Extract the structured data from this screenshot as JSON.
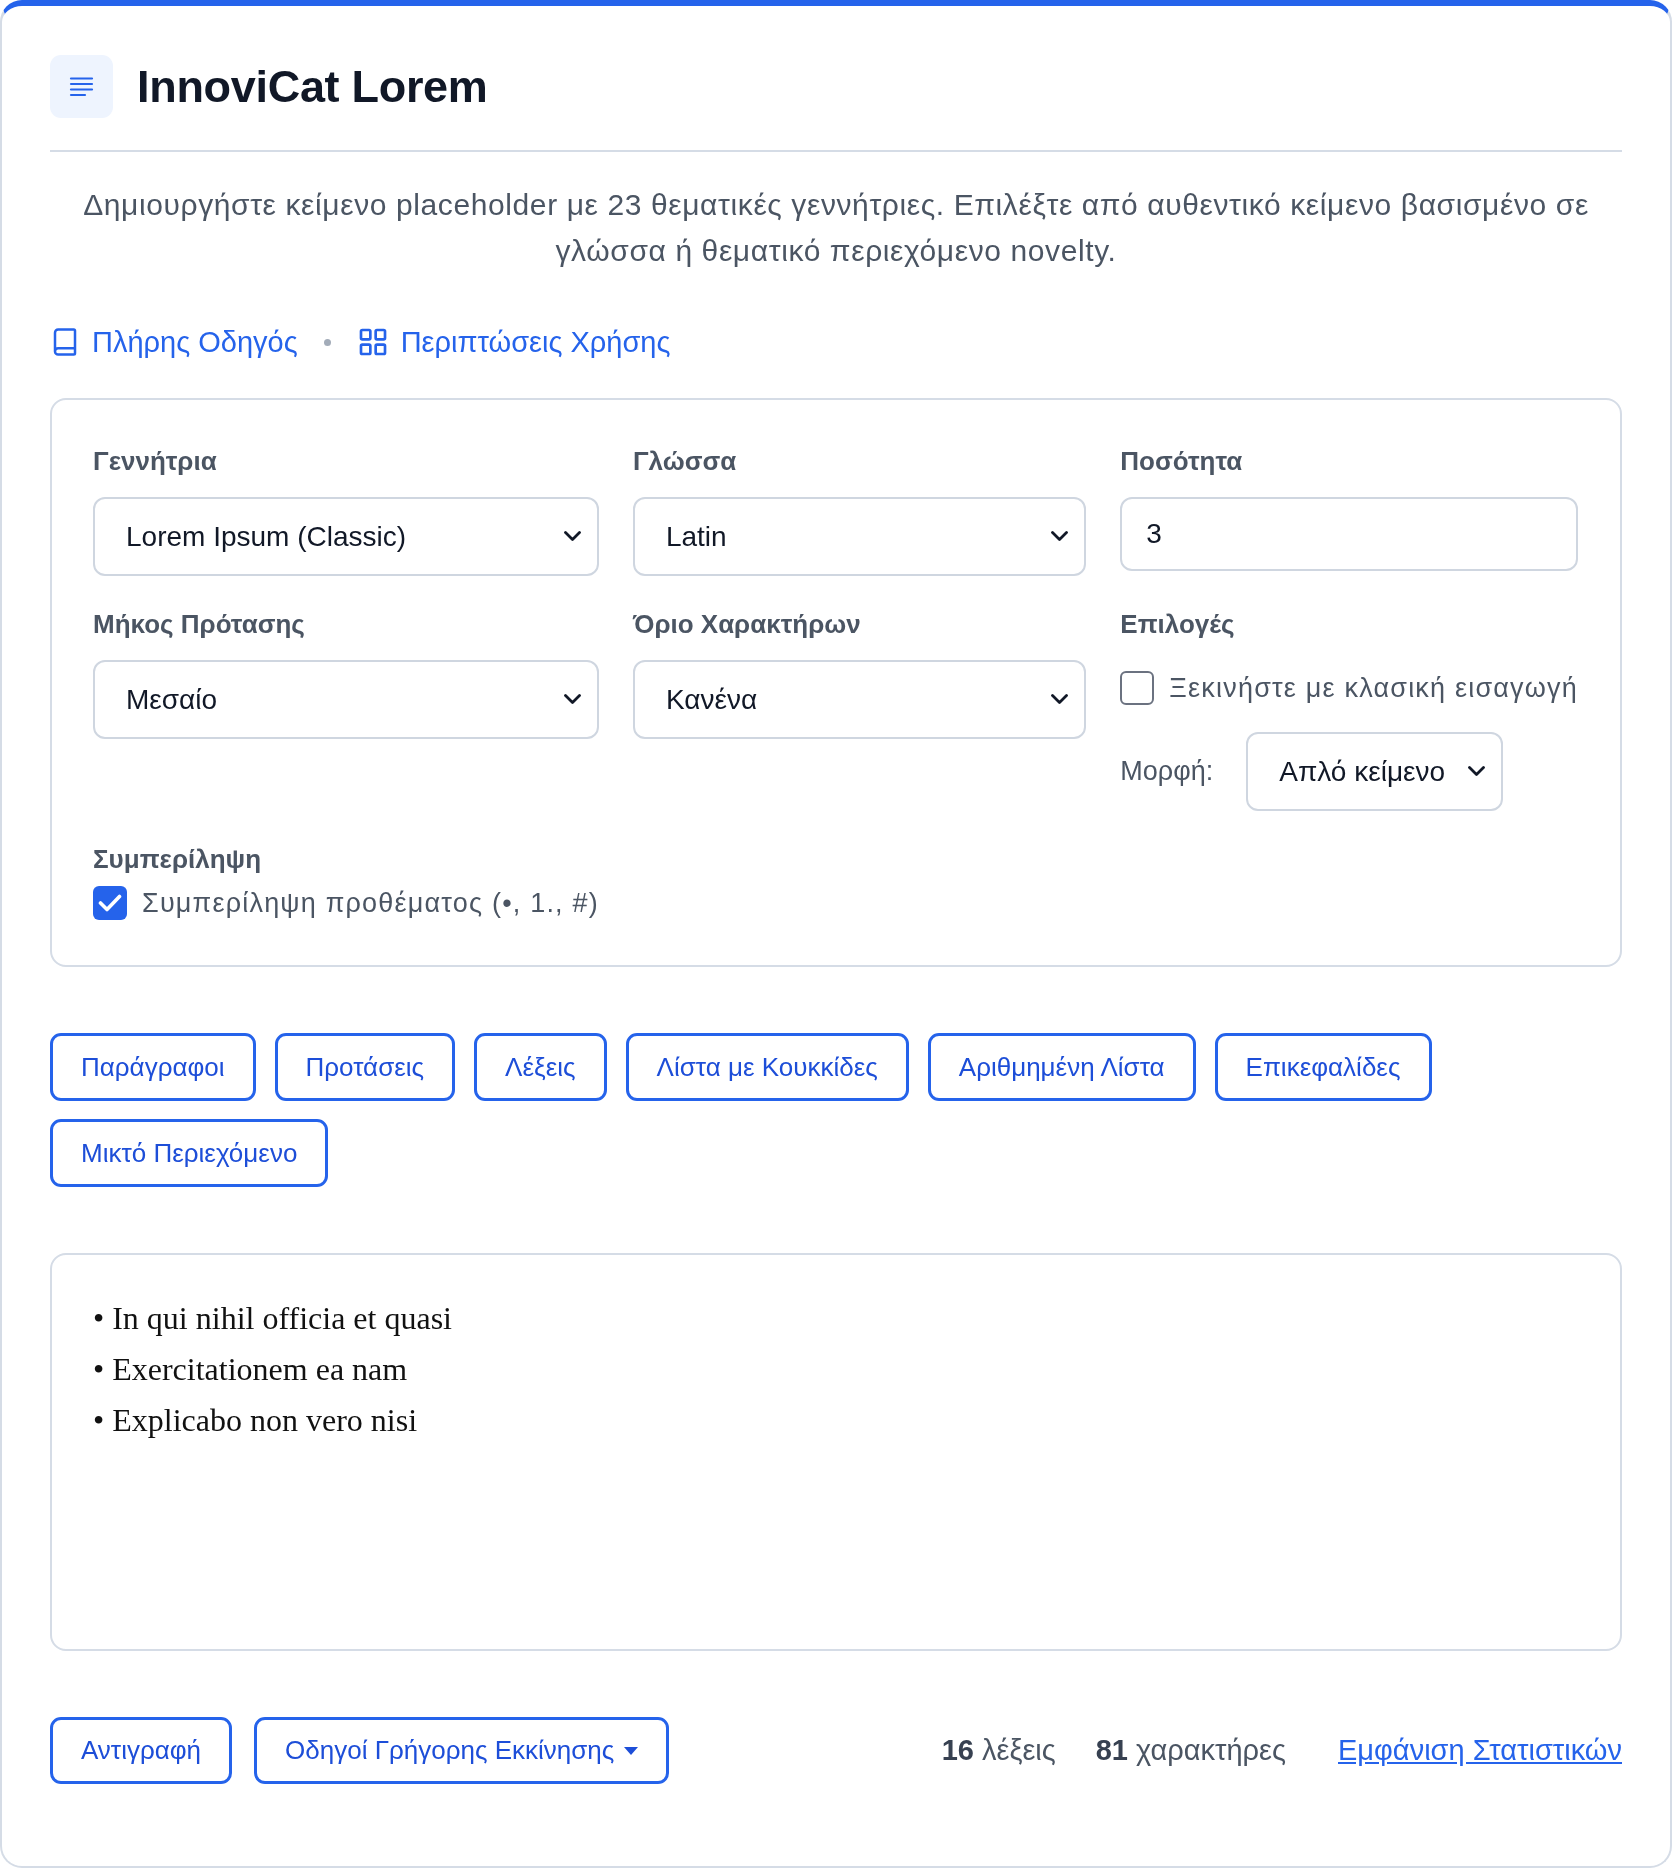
{
  "header": {
    "title": "InnoviCat Lorem"
  },
  "description": "Δημιουργήστε κείμενο placeholder με 23 θεματικές γεννήτριες. Επιλέξτε από αυθεντικό κείμενο βασισμένο σε γλώσσα ή θεματικό περιεχόμενο novelty.",
  "links": {
    "guide": "Πλήρης Οδηγός",
    "use_cases": "Περιπτώσεις Χρήσης"
  },
  "settings": {
    "fields": [
      {
        "kind": "select",
        "label": "Γεννήτρια",
        "value": "Lorem Ipsum (Classic)"
      },
      {
        "kind": "select",
        "label": "Γλώσσα",
        "value": "Latin"
      },
      {
        "kind": "input",
        "label": "Ποσότητα",
        "value": "3"
      },
      {
        "kind": "select",
        "label": "Μήκος Πρότασης",
        "value": "Μεσαίο"
      },
      {
        "kind": "select",
        "label": "Όριο Χαρακτήρων",
        "value": "Κανένα"
      },
      {
        "kind": "options",
        "label": "Επιλογές",
        "checkbox": {
          "label": "Ξεκινήστε με κλασική εισαγωγή",
          "checked": false
        },
        "format": {
          "label": "Μορφή:",
          "value": "Απλό κείμενο"
        }
      },
      {
        "kind": "checkbox_group",
        "label": "Συμπερίληψη",
        "checkbox": {
          "label": "Συμπερίληψη προθέματος (•, 1., #)",
          "checked": true
        }
      }
    ]
  },
  "generate_buttons": [
    "Παράγραφοι",
    "Προτάσεις",
    "Λέξεις",
    "Λίστα με Κουκκίδες",
    "Αριθμημένη Λίστα",
    "Επικεφαλίδες",
    "Μικτό Περιεχόμενο"
  ],
  "output": {
    "lines": [
      "• In qui nihil officia et quasi",
      "• Exercitationem ea nam",
      "• Explicabo non vero nisi"
    ]
  },
  "footer": {
    "copy": "Αντιγραφή",
    "quick_start": "Οδηγοί Γρήγορης Εκκίνησης",
    "stats": {
      "words": "**16** λέξεις",
      "characters": "**81** χαρακτήρες"
    },
    "stats_link": "Εμφάνιση Στατιστικών"
  }
}
